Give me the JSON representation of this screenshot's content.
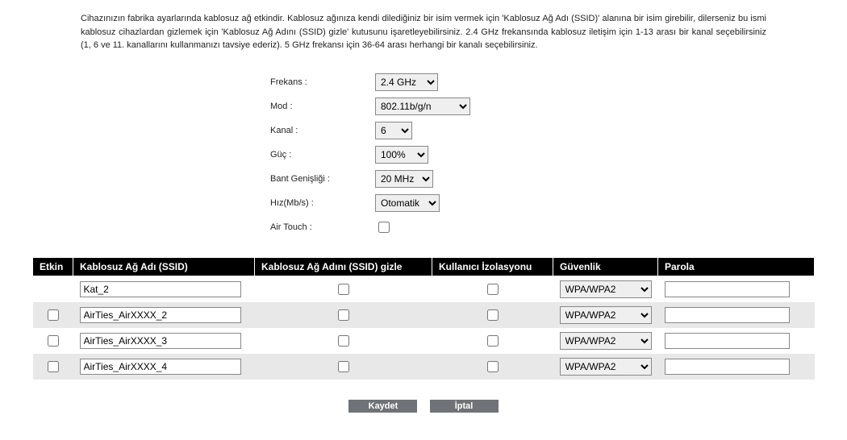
{
  "intro_text": "Cihazınızın fabrika ayarlarında kablosuz ağ etkindir. Kablosuz ağınıza kendi dilediğiniz bir isim vermek için 'Kablosuz Ağ Adı (SSID)' alanına bir isim girebilir, dilerseniz bu ismi kablosuz cihazlardan gizlemek için 'Kablosuz Ağ Adını (SSID) gizle' kutusunu işaretleyebilirsiniz. 2.4 GHz frekansında kablosuz iletişim için 1-13 arası bir kanal seçebilirsiniz (1, 6 ve 11. kanallarını kullanmanızı tavsiye ederiz). 5 GHz frekansı için 36-64 arası herhangi bir kanalı seçebilirsiniz.",
  "settings": {
    "frequency": {
      "label": "Frekans :",
      "value": "2.4 GHz"
    },
    "mode": {
      "label": "Mod :",
      "value": "802.11b/g/n"
    },
    "channel": {
      "label": "Kanal :",
      "value": "6"
    },
    "power": {
      "label": "Güç :",
      "value": "100%"
    },
    "bandwidth": {
      "label": "Bant Genişliği :",
      "value": "20 MHz"
    },
    "rate": {
      "label": "Hız(Mb/s) :",
      "value": "Otomatik"
    },
    "airtouch": {
      "label": "Air Touch :",
      "checked": false
    }
  },
  "table": {
    "headers": {
      "enabled": "Etkin",
      "ssid": "Kablosuz Ağ Adı (SSID)",
      "hide": "Kablosuz Ağ Adını (SSID) gizle",
      "isolation": "Kullanıcı İzolasyonu",
      "security": "Güvenlik",
      "password": "Parola"
    },
    "rows": [
      {
        "enabled": null,
        "ssid": "Kat_2",
        "hide": false,
        "isolation": false,
        "security": "WPA/WPA2",
        "password": ""
      },
      {
        "enabled": false,
        "ssid": "AirTies_AirXXXX_2",
        "hide": false,
        "isolation": false,
        "security": "WPA/WPA2",
        "password": ""
      },
      {
        "enabled": false,
        "ssid": "AirTies_AirXXXX_3",
        "hide": false,
        "isolation": false,
        "security": "WPA/WPA2",
        "password": ""
      },
      {
        "enabled": false,
        "ssid": "AirTies_AirXXXX_4",
        "hide": false,
        "isolation": false,
        "security": "WPA/WPA2",
        "password": ""
      }
    ]
  },
  "buttons": {
    "save": "Kaydet",
    "cancel": "İptal"
  }
}
